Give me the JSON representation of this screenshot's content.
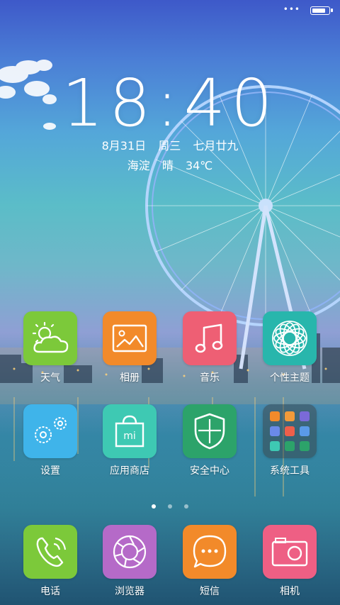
{
  "status_bar": {
    "dots": "•••"
  },
  "lockscreen": {
    "time": "18:40",
    "date": {
      "day": "8月31日",
      "weekday": "周三",
      "lunar": "七月廿九"
    },
    "weather": {
      "location": "海淀",
      "condition": "晴",
      "temperature": "34℃"
    }
  },
  "apps_row1": [
    {
      "label": "天气",
      "icon": "weather-icon",
      "color": "#7cc93a"
    },
    {
      "label": "相册",
      "icon": "gallery-icon",
      "color": "#f28a2a"
    },
    {
      "label": "音乐",
      "icon": "music-icon",
      "color": "#ee5f74"
    },
    {
      "label": "个性主题",
      "icon": "theme-icon",
      "color": "#28b6ac"
    }
  ],
  "apps_row2": [
    {
      "label": "设置",
      "icon": "settings-icon",
      "color": "#3fb4ea"
    },
    {
      "label": "应用商店",
      "icon": "app-store-icon",
      "color": "#3ec9b3"
    },
    {
      "label": "安全中心",
      "icon": "security-icon",
      "color": "#2ca36a"
    },
    {
      "label": "系统工具",
      "icon": "folder-icon",
      "color": "#4a4a4a"
    }
  ],
  "dock": [
    {
      "label": "电话",
      "icon": "phone-icon",
      "color": "#7cc93a"
    },
    {
      "label": "浏览器",
      "icon": "browser-icon",
      "color": "#b56ac8"
    },
    {
      "label": "短信",
      "icon": "sms-icon",
      "color": "#f28a2a"
    },
    {
      "label": "相机",
      "icon": "camera-icon",
      "color": "#ee5f84"
    }
  ],
  "pager": {
    "total": 3,
    "active": 1
  }
}
